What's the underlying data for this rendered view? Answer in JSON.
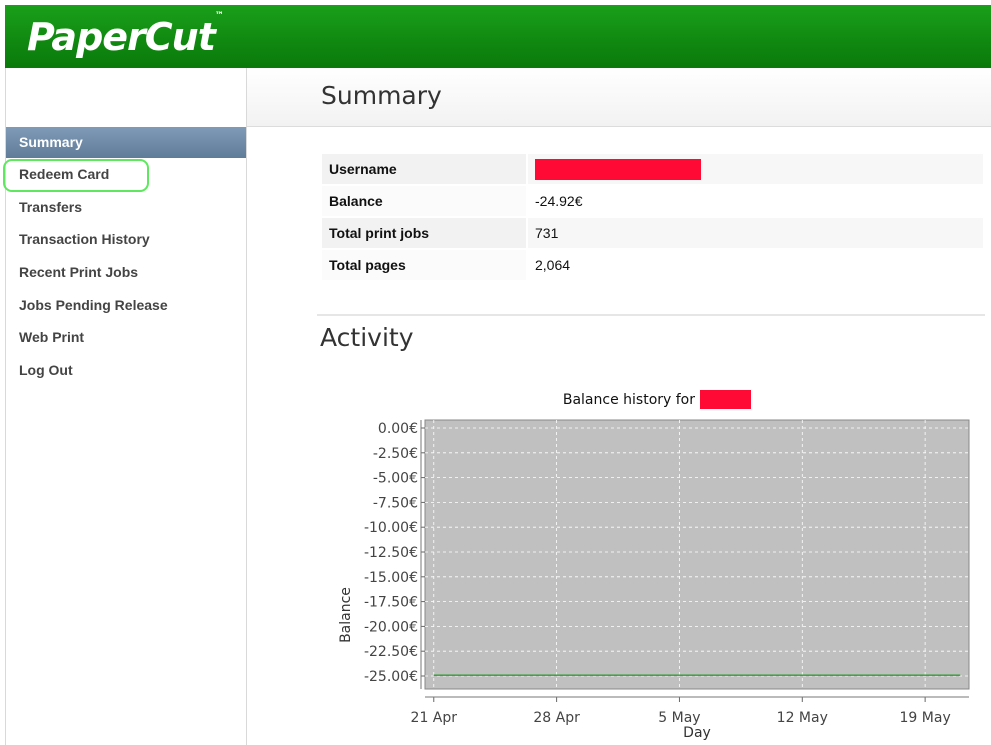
{
  "app": {
    "logo_text": "PaperCut",
    "trademark": "™"
  },
  "sidebar": {
    "items": [
      {
        "label": "Summary",
        "active": true
      },
      {
        "label": "Redeem Card",
        "highlighted": true
      },
      {
        "label": "Transfers"
      },
      {
        "label": "Transaction History"
      },
      {
        "label": "Recent Print Jobs"
      },
      {
        "label": "Jobs Pending Release"
      },
      {
        "label": "Web Print"
      },
      {
        "label": "Log Out"
      }
    ]
  },
  "page": {
    "title": "Summary"
  },
  "summary": {
    "rows": [
      {
        "label": "Username",
        "value": ""
      },
      {
        "label": "Balance",
        "value": "-24.92€"
      },
      {
        "label": "Total print jobs",
        "value": "731"
      },
      {
        "label": "Total pages",
        "value": "2,064"
      }
    ]
  },
  "activity": {
    "title": "Activity"
  },
  "colors": {
    "header_green": "#108810",
    "redaction": "#ff0a35",
    "plot_bg": "#c0c0c0",
    "series_line": "#2e9b2e",
    "highlight_ring": "#5de85d"
  },
  "chart_data": {
    "type": "line",
    "title": "Balance history for",
    "xlabel": "Day",
    "ylabel": "Balance",
    "ylim": [
      -25,
      0
    ],
    "y_ticks": [
      "0.00€",
      "-2.50€",
      "-5.00€",
      "-7.50€",
      "-10.00€",
      "-12.50€",
      "-15.00€",
      "-17.50€",
      "-20.00€",
      "-22.50€",
      "-25.00€"
    ],
    "y_tick_values": [
      0,
      -2.5,
      -5,
      -7.5,
      -10,
      -12.5,
      -15,
      -17.5,
      -20,
      -22.5,
      -25
    ],
    "x_ticks": [
      "21 Apr",
      "28 Apr",
      "5 May",
      "12 May",
      "19 May"
    ],
    "x_tick_days": [
      0,
      7,
      14,
      21,
      28
    ],
    "xlim_days": [
      -0.5,
      30.5
    ],
    "grid": true,
    "series": [
      {
        "x_days": [
          0,
          30
        ],
        "values": [
          -24.92,
          -24.92
        ]
      }
    ]
  }
}
